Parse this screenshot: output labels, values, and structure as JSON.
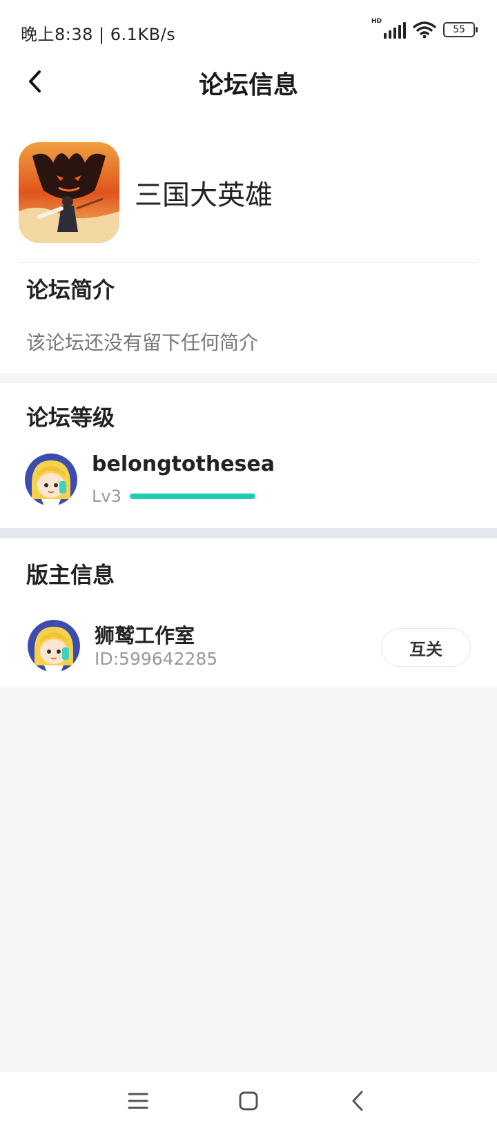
{
  "status_bar": {
    "time_network": "晚上8:38 | 6.1KB/s",
    "network_type": "HD",
    "battery_level": "55"
  },
  "header": {
    "title": "论坛信息"
  },
  "forum": {
    "name": "三国大英雄",
    "intro_title": "论坛简介",
    "intro_text": "该论坛还没有留下任何简介"
  },
  "level": {
    "section_title": "论坛等级",
    "username": "belongtothesea",
    "level_label": "Lv3",
    "progress": 1.0,
    "progress_color": "#1ecdb6"
  },
  "moderator": {
    "section_title": "版主信息",
    "name": "狮鹫工作室",
    "id_text": "ID:599642285",
    "follow_label": "互关"
  },
  "icons": {
    "back": "chevron-left-icon",
    "wifi": "wifi-icon",
    "signal": "signal-icon",
    "battery": "battery-icon",
    "menu": "menu-icon",
    "home": "home-icon",
    "nav_back": "nav-back-icon"
  }
}
